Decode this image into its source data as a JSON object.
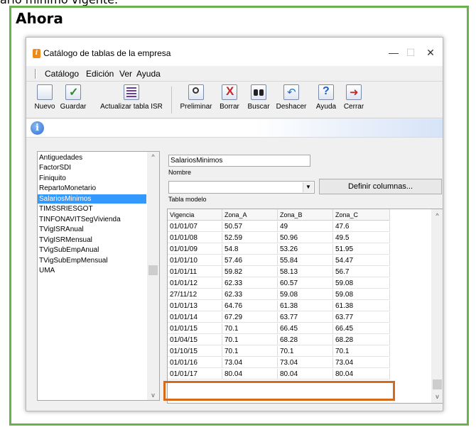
{
  "page": {
    "caption_partial": "ario mínimo vigente.",
    "section_title": "Ahora"
  },
  "window": {
    "title": "Catálogo de tablas de la empresa",
    "minimize": "—",
    "maximize": "☐",
    "close": "✕"
  },
  "menu": [
    "Catálogo",
    "Edición",
    "Ver",
    "Ayuda"
  ],
  "toolbar": [
    {
      "label": "Nuevo",
      "icon": "new-document-icon"
    },
    {
      "label": "Guardar",
      "icon": "save-check-icon"
    },
    {
      "label": "Actualizar tabla ISR",
      "icon": "update-table-icon"
    },
    {
      "label": "Preliminar",
      "icon": "preview-icon"
    },
    {
      "label": "Borrar",
      "icon": "delete-icon"
    },
    {
      "label": "Buscar",
      "icon": "binoculars-icon"
    },
    {
      "label": "Deshacer",
      "icon": "undo-icon"
    },
    {
      "label": "Ayuda",
      "icon": "help-icon"
    },
    {
      "label": "Cerrar",
      "icon": "exit-icon"
    }
  ],
  "tables_list": {
    "items": [
      "Antiguedades",
      "FactorSDI",
      "Finiquito",
      "RepartoMonetario",
      "SalariosMinimos",
      "TIMSSRIESGOT",
      "TINFONAVITSegVivienda",
      "TVigISRAnual",
      "TVigISRMensual",
      "TVigSubEmpAnual",
      "TVigSubEmpMensual",
      "UMA"
    ],
    "selected": "SalariosMinimos"
  },
  "form": {
    "name_value": "SalariosMinimos",
    "name_label": "Nombre",
    "model_value": "",
    "model_label": "Tabla modelo",
    "define_columns_button": "Definir columnas..."
  },
  "grid": {
    "headers": [
      "Vigencia",
      "Zona_A",
      "Zona_B",
      "Zona_C"
    ],
    "rows": [
      [
        "01/01/07",
        "50.57",
        "49",
        "47.6"
      ],
      [
        "01/01/08",
        "52.59",
        "50.96",
        "49.5"
      ],
      [
        "01/01/09",
        "54.8",
        "53.26",
        "51.95"
      ],
      [
        "01/01/10",
        "57.46",
        "55.84",
        "54.47"
      ],
      [
        "01/01/11",
        "59.82",
        "58.13",
        "56.7"
      ],
      [
        "01/01/12",
        "62.33",
        "60.57",
        "59.08"
      ],
      [
        "27/11/12",
        "62.33",
        "59.08",
        "59.08"
      ],
      [
        "01/01/13",
        "64.76",
        "61.38",
        "61.38"
      ],
      [
        "01/01/14",
        "67.29",
        "63.77",
        "63.77"
      ],
      [
        "01/01/15",
        "70.1",
        "66.45",
        "66.45"
      ],
      [
        "01/04/15",
        "70.1",
        "68.28",
        "68.28"
      ],
      [
        "01/10/15",
        "70.1",
        "70.1",
        "70.1"
      ],
      [
        "01/01/16",
        "73.04",
        "73.04",
        "73.04"
      ],
      [
        "01/01/17",
        "80.04",
        "80.04",
        "80.04"
      ]
    ],
    "highlight_color": "#d7691a"
  },
  "colors": {
    "frame_border": "#6ab34a",
    "selection": "#3399ff"
  }
}
